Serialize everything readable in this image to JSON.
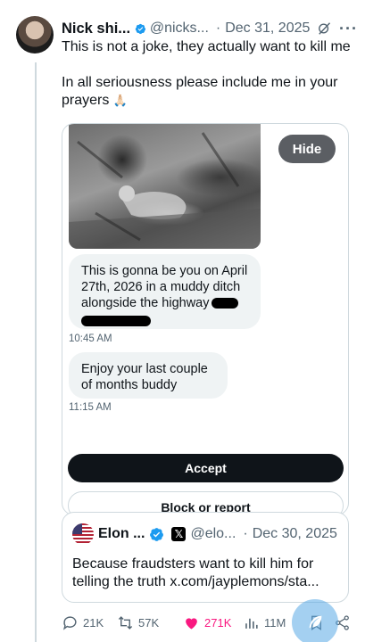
{
  "tweet": {
    "author_name": "Nick shi...",
    "handle": "@nicks...",
    "separator": "·",
    "date": "Dec 31, 2025",
    "text_line1": "This is not a joke, they actually want to kill me",
    "text_line2": "In all seriousness please include me in your prayers",
    "emoji": "🙏🏻"
  },
  "media": {
    "hide_label": "Hide",
    "messages": [
      {
        "text": "This is gonna be you on April 27th, 2026 in a  muddy ditch alongside the highway",
        "time": "10:45 AM"
      },
      {
        "text": "Enjoy your last couple of months buddy",
        "time": "11:15 AM"
      }
    ],
    "accept_label": "Accept",
    "block_label": "Block or report"
  },
  "quote": {
    "author_name": "Elon ...",
    "handle": "@elo...",
    "separator": "·",
    "date": "Dec 30, 2025",
    "text": "Because fraudsters want to kill him for telling the truth x.com/jayplemons/sta..."
  },
  "actions": {
    "replies": "21K",
    "reposts": "57K",
    "likes": "271K",
    "views": "11M"
  },
  "colors": {
    "verified": "#1d9bf0",
    "like": "#f91880",
    "muted": "#536471"
  }
}
